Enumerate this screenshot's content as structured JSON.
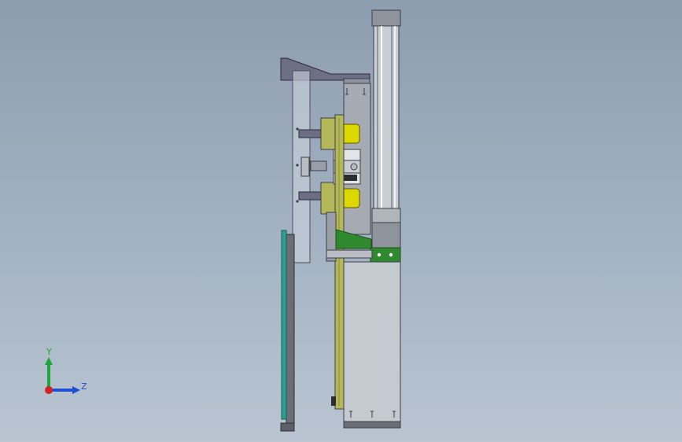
{
  "viewport": {
    "background_top": "#8d9db0",
    "background_bottom": "#b9c5d1"
  },
  "triad": {
    "y_label": "Y",
    "z_label": "Z",
    "y_color": "#1fa83a",
    "z_color": "#1e4fd6",
    "x_color": "#d42020"
  },
  "colors": {
    "steel": "#b9bcc3",
    "steel_dark": "#8f939c",
    "edge": "#3a3e48",
    "yellow": "#dcd800",
    "olive": "#b4b85a",
    "green": "#2f8a2f",
    "teal": "#2e9e93",
    "gray_plate": "#6b6e76",
    "bracket": "#6e6e86"
  }
}
